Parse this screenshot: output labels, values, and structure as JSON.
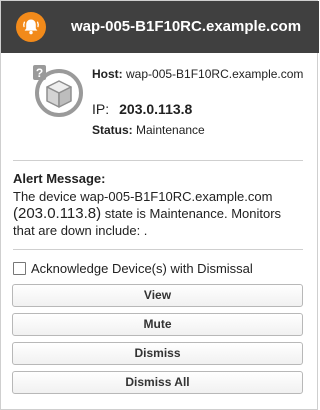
{
  "header": {
    "title": "wap-005-B1F10RC.example.com",
    "icon": "bell-icon",
    "accent_color": "#f28a1a",
    "background_color": "#404040"
  },
  "device": {
    "icon": "unknown-device-icon",
    "host_label": "Host:",
    "host_value": "wap-005-B1F10RC.example.com",
    "ip_label": "IP:",
    "ip_value": "203.0.113.8",
    "status_label": "Status:",
    "status_value": "Maintenance"
  },
  "alert": {
    "title": "Alert Message:",
    "line1": "The device wap-005-B1F10RC.example.com",
    "ip_open": "(",
    "ip": "203.0.113.8",
    "ip_close": ")",
    "line2_rest": " state is Maintenance. Monitors",
    "line3": "that are down include: ."
  },
  "acknowledge": {
    "label": "Acknowledge Device(s) with Dismissal",
    "checked": false
  },
  "buttons": {
    "view": "View",
    "mute": "Mute",
    "dismiss": "Dismiss",
    "dismiss_all": "Dismiss All"
  }
}
